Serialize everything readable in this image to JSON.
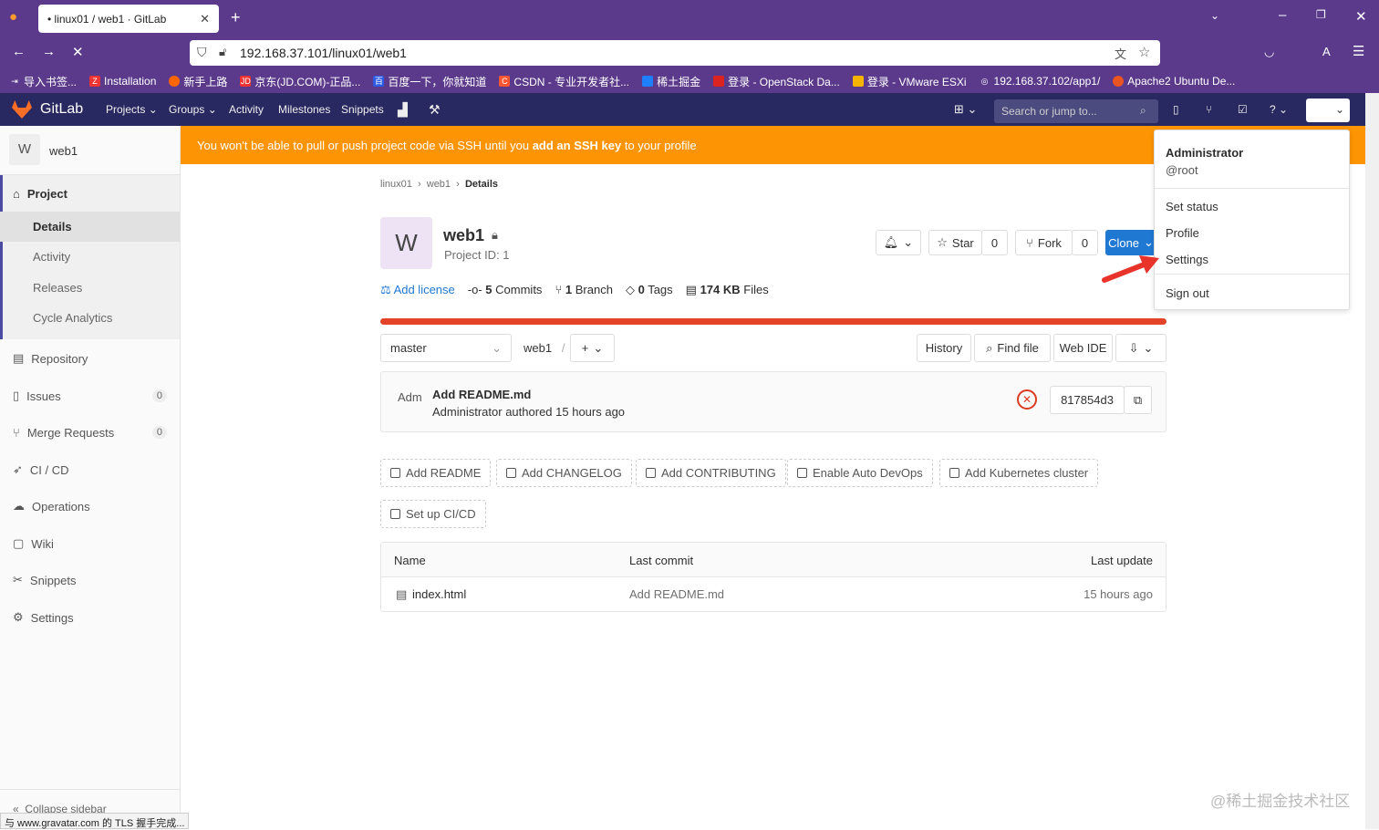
{
  "browser": {
    "tab_title": "• linux01 / web1 · GitLab",
    "url": "192.168.37.101/linux01/web1",
    "bookmarks": [
      "导入书签...",
      "Installation",
      "新手上路",
      "京东(JD.COM)-正品...",
      "百度一下，你就知道",
      "CSDN - 专业开发者社...",
      "稀土掘金",
      "登录 - OpenStack Da...",
      "登录 - VMware ESXi",
      "192.168.37.102/app1/",
      "Apache2 Ubuntu De..."
    ],
    "status_text": "与 www.gravatar.com 的 TLS 握手完成..."
  },
  "header": {
    "brand": "GitLab",
    "nav": [
      "Projects",
      "Groups",
      "Activity",
      "Milestones",
      "Snippets"
    ],
    "search_placeholder": "Search or jump to..."
  },
  "sidebar": {
    "project_initial": "W",
    "project_name": "web1",
    "project_label": "Project",
    "sub_items": [
      "Details",
      "Activity",
      "Releases",
      "Cycle Analytics"
    ],
    "items": [
      {
        "label": "Repository",
        "count": ""
      },
      {
        "label": "Issues",
        "count": "0"
      },
      {
        "label": "Merge Requests",
        "count": "0"
      },
      {
        "label": "CI / CD",
        "count": ""
      },
      {
        "label": "Operations",
        "count": ""
      },
      {
        "label": "Wiki",
        "count": ""
      },
      {
        "label": "Snippets",
        "count": ""
      },
      {
        "label": "Settings",
        "count": ""
      }
    ],
    "collapse": "Collapse sidebar"
  },
  "banner": {
    "pre": "You won't be able to pull or push project code via SSH until you ",
    "link": "add an SSH key",
    "post": " to your profile"
  },
  "breadcrumb": [
    "linux01",
    "web1",
    "Details"
  ],
  "project": {
    "initial": "W",
    "name": "web1",
    "id": "Project ID: 1",
    "star": "Star",
    "star_count": "0",
    "fork": "Fork",
    "fork_count": "0",
    "clone": "Clone",
    "add_license": "Add license",
    "commits_n": "5",
    "commits": "Commits",
    "branch_n": "1",
    "branch": "Branch",
    "tags_n": "0",
    "tags": "Tags",
    "files_n": "174 KB",
    "files": "Files",
    "colors": {
      "accent": "#1f78d1",
      "bar": "#e24329",
      "banner": "#fc9403",
      "header": "#292961"
    }
  },
  "repo": {
    "branch": "master",
    "path": "web1",
    "history": "History",
    "find_file": "Find file",
    "web_ide": "Web IDE"
  },
  "commit": {
    "avatar_text": "Adm",
    "title": "Add README.md",
    "author": "Administrator",
    "meta": "authored 15 hours ago",
    "sha": "817854d3"
  },
  "quick_actions": [
    "Add README",
    "Add CHANGELOG",
    "Add CONTRIBUTING",
    "Enable Auto DevOps",
    "Add Kubernetes cluster",
    "Set up CI/CD"
  ],
  "table": {
    "headers": [
      "Name",
      "Last commit",
      "Last update"
    ],
    "rows": [
      {
        "name": "index.html",
        "commit": "Add README.md",
        "update": "15 hours ago"
      }
    ]
  },
  "user_menu": {
    "name": "Administrator",
    "handle": "@root",
    "items": [
      "Set status",
      "Profile",
      "Settings",
      "Sign out"
    ]
  },
  "watermark": "@稀土掘金技术社区"
}
